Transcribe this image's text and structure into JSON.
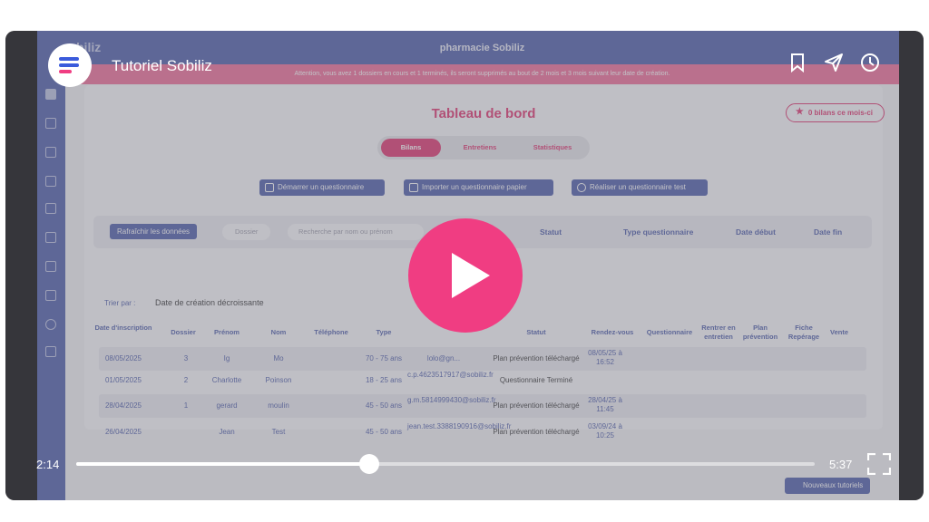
{
  "app": {
    "brand": "biliz",
    "pharmacy": "pharmacie Sobiliz",
    "alert": "Attention, vous avez 1 dossiers en cours et 1 terminés, ils seront supprimés au bout de 2 mois et 3 mois suivant leur date de création.",
    "title": "Tableau de bord",
    "bilans_badge": "0 bilans ce mois-ci",
    "tabs": [
      "Bilans",
      "Entretiens",
      "Statistiques"
    ],
    "actions": [
      "Démarrer un questionnaire",
      "Importer un questionnaire papier",
      "Réaliser un questionnaire test"
    ],
    "filters": {
      "refresh": "Rafraîchir les données",
      "dossier": "Dossier",
      "search_placeholder": "Recherche par nom ou prénom",
      "statut": "Statut",
      "type": "Type questionnaire",
      "date_debut": "Date début",
      "date_fin": "Date fin"
    },
    "sort": {
      "label": "Trier par :",
      "value": "Date de création décroissante"
    },
    "columns": [
      "Date d'inscription",
      "Dossier",
      "Prénom",
      "Nom",
      "Téléphone",
      "Type",
      "Statut",
      "Rendez-vous",
      "Questionnaire",
      "Rentrer en entretien",
      "Plan prévention",
      "Fiche Repérage",
      "Vente"
    ],
    "rows": [
      {
        "date": "08/05/2025",
        "dossier": "3",
        "prenom": "Ig",
        "nom": "Mo",
        "type": "70 - 75 ans",
        "email": "lolo@gn...",
        "statut": "Plan prévention téléchargé",
        "rdv": "08/05/25 à 16:52"
      },
      {
        "date": "01/05/2025",
        "dossier": "2",
        "prenom": "Charlotte",
        "nom": "Poinson",
        "type": "18 - 25 ans",
        "email": "c.p.4623517917@sobiliz.fr",
        "statut": "Questionnaire Terminé",
        "rdv": ""
      },
      {
        "date": "28/04/2025",
        "dossier": "1",
        "prenom": "gerard",
        "nom": "moulin",
        "type": "45 - 50 ans",
        "email": "g.m.5814999430@sobiliz.fr",
        "statut": "Plan prévention téléchargé",
        "rdv": "28/04/25 à 11:45"
      },
      {
        "date": "26/04/2025",
        "dossier": "",
        "prenom": "Jean",
        "nom": "Test",
        "type": "45 - 50 ans",
        "email": "jean.test.3388190916@sobiliz.fr",
        "statut": "Plan prévention téléchargé",
        "rdv": "03/09/24 à 10:25"
      }
    ],
    "new_tutorials": "Nouveaux tutoriels"
  },
  "player": {
    "title": "Tutoriel Sobiliz",
    "current_time": "2:14",
    "duration": "5:37",
    "progress_fraction": 0.397
  },
  "colors": {
    "accent": "#e0316c",
    "primary": "#4a5aa8",
    "play": "#f03d82"
  }
}
